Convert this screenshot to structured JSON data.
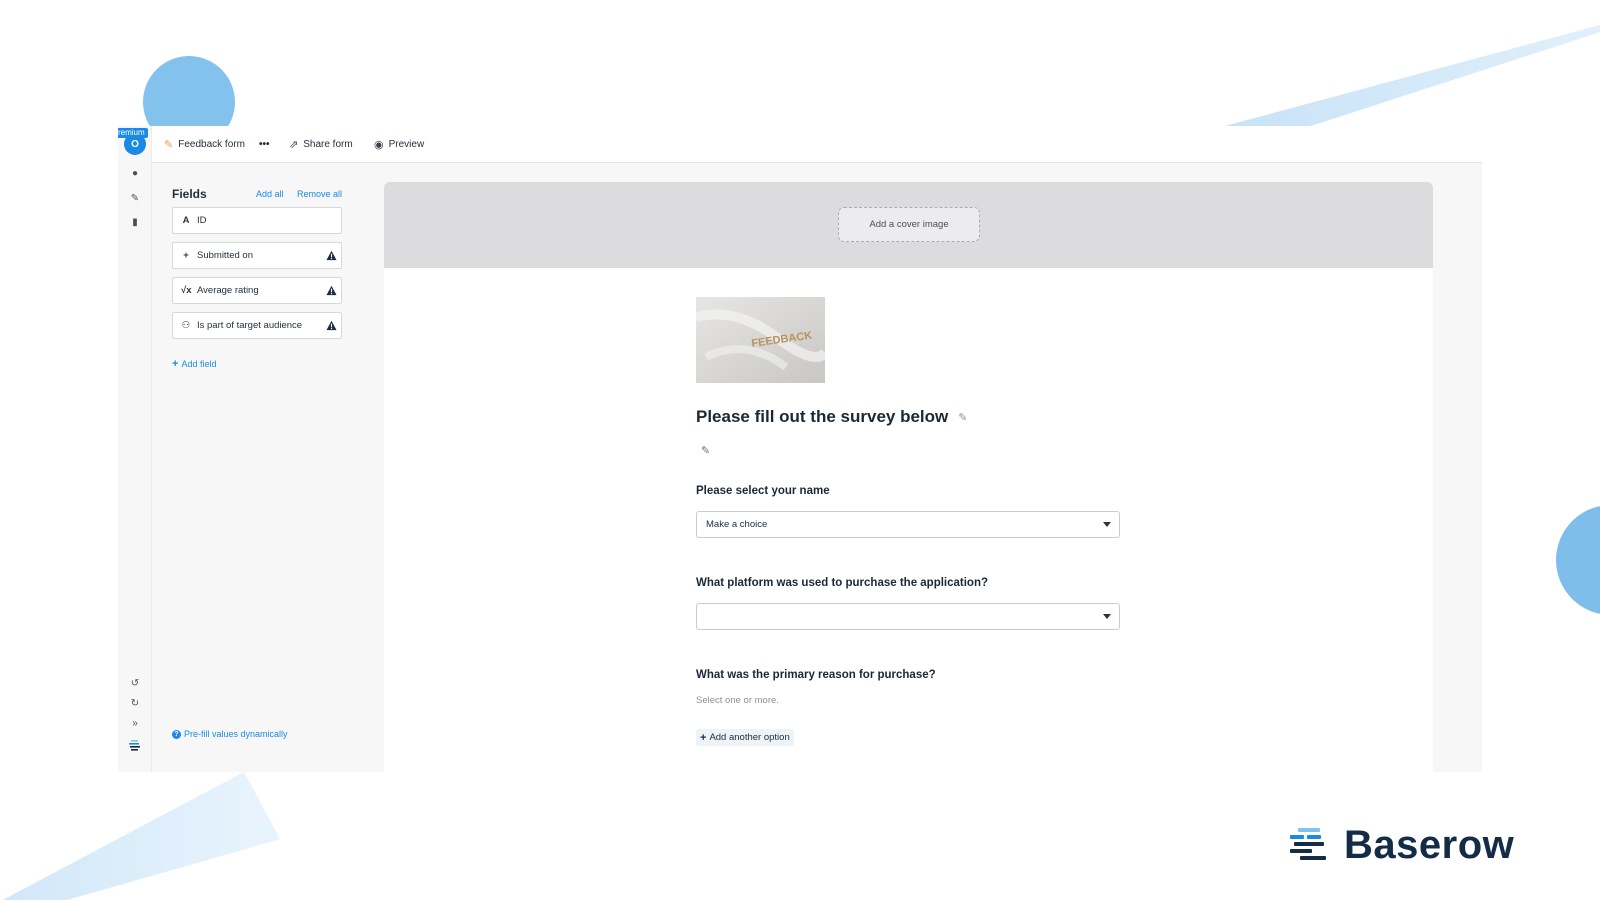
{
  "app": {
    "premium_label": "remium",
    "avatar_initial": "O"
  },
  "topbar": {
    "view_name": "Feedback form",
    "more_label": "•••",
    "share_label": "Share form",
    "preview_label": "Preview"
  },
  "sidebar": {
    "title": "Fields",
    "add_all": "Add all",
    "remove_all": "Remove all",
    "fields": [
      {
        "label": "ID",
        "icon": "text-icon",
        "glyph": "A",
        "warning": false
      },
      {
        "label": "Submitted on",
        "icon": "plus-icon",
        "glyph": "+",
        "warning": true
      },
      {
        "label": "Average rating",
        "icon": "formula-icon",
        "glyph": "√x",
        "warning": true
      },
      {
        "label": "Is part of target audience",
        "icon": "binoculars-icon",
        "glyph": "⚇",
        "warning": true
      }
    ],
    "add_field": "Add field",
    "prefill": "Pre-fill values dynamically"
  },
  "form": {
    "cover_button": "Add a cover image",
    "logo_text": "FEEDBACK",
    "title": "Please fill out the survey below",
    "questions": [
      {
        "label": "Please select your name",
        "value": "Make a choice"
      },
      {
        "label": "What platform was used to purchase the application?",
        "value": ""
      },
      {
        "label": "What was the primary reason for purchase?",
        "hint": "Select one or more.",
        "add_option": "Add another option"
      }
    ]
  },
  "brand": {
    "name": "Baserow",
    "colors": {
      "accent": "#1a8ae6",
      "dark": "#152c46",
      "light": "#84c2ee"
    }
  }
}
